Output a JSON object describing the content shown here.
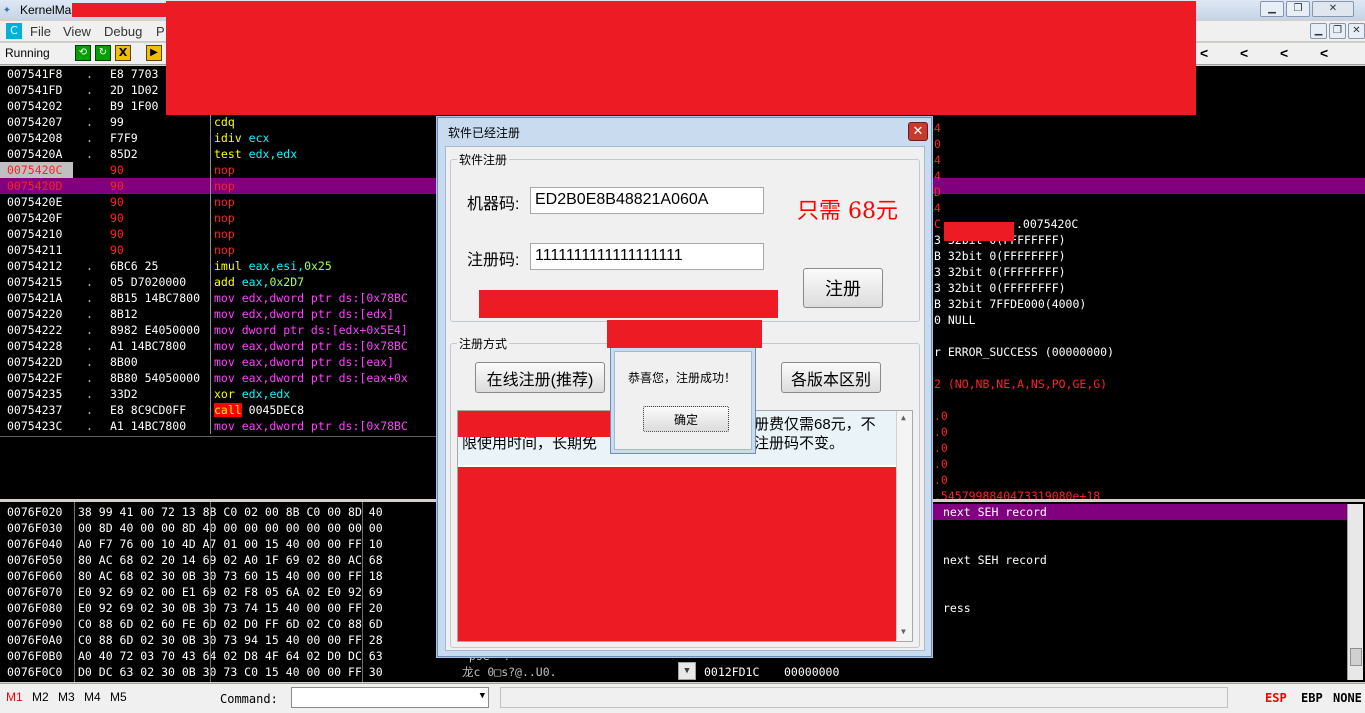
{
  "window": {
    "title": "KernelMa",
    "status": "Running"
  },
  "menu": [
    "File",
    "View",
    "Debug",
    "P"
  ],
  "toolbar": {
    "run_icon": "run-icon",
    "stop_label": "X"
  },
  "nav_arrows": [
    "<",
    "<",
    "<",
    "<"
  ],
  "disasm": [
    {
      "addr": "007541F8",
      "m": ".",
      "hex": "E8 7703",
      "ins": ""
    },
    {
      "addr": "007541FD",
      "m": ".",
      "hex": "2D 1D02",
      "ins": ""
    },
    {
      "addr": "00754202",
      "m": ".",
      "hex": "B9 1F00",
      "ins": ""
    },
    {
      "addr": "00754207",
      "m": ".",
      "hex": "99",
      "ins": "cdq"
    },
    {
      "addr": "00754208",
      "m": ".",
      "hex": "F7F9",
      "ins": "idiv ecx"
    },
    {
      "addr": "0075420A",
      "m": ".",
      "hex": "85D2",
      "ins": "test edx,edx"
    },
    {
      "addr": "0075420C",
      "m": "",
      "hex": "90",
      "ins": "nop"
    },
    {
      "addr": "0075420D",
      "m": "",
      "hex": "90",
      "ins": "nop"
    },
    {
      "addr": "0075420E",
      "m": "",
      "hex": "90",
      "ins": "nop"
    },
    {
      "addr": "0075420F",
      "m": "",
      "hex": "90",
      "ins": "nop"
    },
    {
      "addr": "00754210",
      "m": "",
      "hex": "90",
      "ins": "nop"
    },
    {
      "addr": "00754211",
      "m": "",
      "hex": "90",
      "ins": "nop"
    },
    {
      "addr": "00754212",
      "m": ".",
      "hex": "6BC6 25",
      "ins": "imul eax,esi,0x25"
    },
    {
      "addr": "00754215",
      "m": ".",
      "hex": "05 D7020000",
      "ins": "add eax,0x2D7"
    },
    {
      "addr": "0075421A",
      "m": ".",
      "hex": "8B15 14BC7800",
      "ins": "mov edx,dword ptr ds:[0x78BC"
    },
    {
      "addr": "00754220",
      "m": ".",
      "hex": "8B12",
      "ins": "mov edx,dword ptr ds:[edx]"
    },
    {
      "addr": "00754222",
      "m": ".",
      "hex": "8982 E4050000",
      "ins": "mov dword ptr ds:[edx+0x5E4]"
    },
    {
      "addr": "00754228",
      "m": ".",
      "hex": "A1 14BC7800",
      "ins": "mov eax,dword ptr ds:[0x78BC"
    },
    {
      "addr": "0075422D",
      "m": ".",
      "hex": "8B00",
      "ins": "mov eax,dword ptr ds:[eax]"
    },
    {
      "addr": "0075422F",
      "m": ".",
      "hex": "8B80 54050000",
      "ins": "mov eax,dword ptr ds:[eax+0x"
    },
    {
      "addr": "00754235",
      "m": ".",
      "hex": "33D2",
      "ins": "xor edx,edx"
    },
    {
      "addr": "00754237",
      "m": ".",
      "hex": "E8 8C9CD0FF",
      "ins": "call 0045DEC8"
    },
    {
      "addr": "0075423C",
      "m": ".",
      "hex": "A1 14BC7800",
      "ins": "mov eax,dword ptr ds:[0x78BC"
    }
  ],
  "registers": [
    {
      "t": "4"
    },
    {
      "t": "0"
    },
    {
      "t": "4"
    },
    {
      "t": "4"
    },
    {
      "t": "D"
    },
    {
      "t": "4"
    },
    {
      "t": "C",
      "tail": ".0075420C"
    },
    {
      "t": "3 32bit 0(FFFFFFFF)"
    },
    {
      "t": "B 32bit 0(FFFFFFFF)"
    },
    {
      "t": "3 32bit 0(FFFFFFFF)"
    },
    {
      "t": "3 32bit 0(FFFFFFFF)"
    },
    {
      "t": "B 32bit 7FFDE000(4000)"
    },
    {
      "t": "0 NULL"
    },
    {
      "t": ""
    },
    {
      "t": "r ERROR_SUCCESS (00000000)"
    },
    {
      "t": ""
    },
    {
      "t": "2 (NO,NB,NE,A,NS,PO,GE,G)"
    },
    {
      "t": ""
    },
    {
      "t": ".0"
    },
    {
      "t": ".0"
    },
    {
      "t": ".0"
    },
    {
      "t": ".0"
    },
    {
      "t": ".0"
    },
    {
      "t": ".5457998840473319080e+18"
    }
  ],
  "dump": [
    {
      "addr": "0076F020",
      "hex": "38 99 41 00 72 13 8B C0 02 00 8B C0 00 8D 40"
    },
    {
      "addr": "0076F030",
      "hex": "00 8D 40 00 00 8D 40 00 00 00 00 00 00 00 00"
    },
    {
      "addr": "0076F040",
      "hex": "A0 F7 76 00 10 4D A7 01 00 15 40 00 00 FF 10"
    },
    {
      "addr": "0076F050",
      "hex": "80 AC 68 02 20 14 69 02 A0 1F 69 02 80 AC 68"
    },
    {
      "addr": "0076F060",
      "hex": "80 AC 68 02 30 0B 30 73 60 15 40 00 00 FF 18"
    },
    {
      "addr": "0076F070",
      "hex": "E0 92 69 02 00 E1 69 02 F8 05 6A 02 E0 92 69"
    },
    {
      "addr": "0076F080",
      "hex": "E0 92 69 02 30 0B 30 73 74 15 40 00 00 FF 20"
    },
    {
      "addr": "0076F090",
      "hex": "C0 88 6D 02 60 FE 6D 02 D0 FF 6D 02 C0 88 6D"
    },
    {
      "addr": "0076F0A0",
      "hex": "C0 88 6D 02 30 0B 30 73 94 15 40 00 00 FF 28"
    },
    {
      "addr": "0076F0B0",
      "hex": "A0 40 72 03 70 43 64 02 D8 4F 64 02 D0 DC 63"
    },
    {
      "addr": "0076F0C0",
      "hex": "D0 DC 63 02 30 0B 30 73 C0 15 40 00 00 FF 30"
    }
  ],
  "dump_ascii": [
    " pse  ?   ",
    "龙c 0□s?@..U0."
  ],
  "stack": [
    {
      "text": "next SEH record",
      "hl": true
    },
    {
      "text": ""
    },
    {
      "text": ""
    },
    {
      "text": "next SEH record",
      "hl": false
    },
    {
      "text": ""
    },
    {
      "text": ""
    },
    {
      "text": "ress",
      "hl": false
    }
  ],
  "stack_bottom": {
    "addr": "0012FD1C",
    "val": "00000000"
  },
  "bottom": {
    "tabs": [
      "M1",
      "M2",
      "M3",
      "M4",
      "M5"
    ],
    "command_label": "Command:",
    "regs": [
      "ESP",
      "EBP",
      "NONE"
    ]
  },
  "dialog": {
    "title": "软件已经注册",
    "group1": "软件注册",
    "machine_label": "机器码:",
    "machine_value": "ED2B0E8B48821A060A",
    "price": "只需 68元",
    "reg_label": "注册码:",
    "reg_value": "1111111111111111111",
    "register_btn": "注册",
    "group2": "注册方式",
    "online_btn": "在线注册(推荐)",
    "version_btn": "各版本区别",
    "info_line1": "册费仅需68元，不",
    "info_line2a": "限使用时间，长期免",
    "info_line2b": "注册码不变。"
  },
  "msgbox": {
    "message": "恭喜您，注册成功！",
    "ok": "确定"
  },
  "colors": {
    "highlight": "#800080",
    "accent": "#ed1c24"
  }
}
